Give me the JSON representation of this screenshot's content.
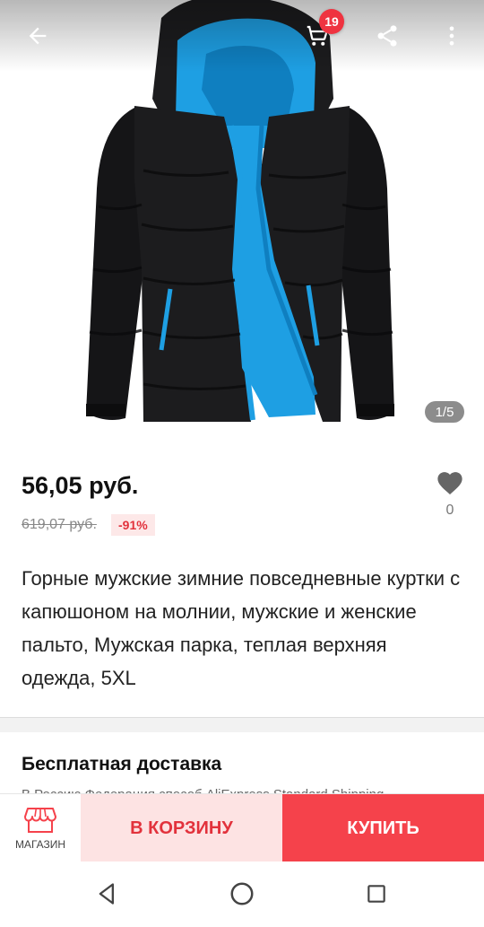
{
  "colors": {
    "accent": "#f5424b",
    "accent_light": "#fde3e3",
    "badge": "#ef3340",
    "jacket_body": "#1c1c1e",
    "jacket_lining": "#1e9fe3"
  },
  "header": {
    "back_icon": "arrow-left-icon",
    "cart_icon": "cart-icon",
    "cart_count": "19",
    "share_icon": "share-icon",
    "more_icon": "more-vertical-icon"
  },
  "gallery": {
    "counter": "1/5"
  },
  "product": {
    "price": "56,05 руб.",
    "old_price": "619,07 руб.",
    "discount": "-91%",
    "wishlist_count": "0",
    "title": "Горные мужские зимние повседневные куртки с капюшоном на молнии, мужские и женские пальто, Мужская парка, теплая верхняя одежда, 5XL"
  },
  "shipping": {
    "title": "Бесплатная доставка",
    "subtitle": "В Россию Федерация способ AliExpress Standard Shipping"
  },
  "actions": {
    "store_label": "МАГАЗИН",
    "add_to_cart": "В КОРЗИНУ",
    "buy": "КУПИТЬ"
  },
  "system_nav": {
    "back_icon": "nav-back-icon",
    "home_icon": "nav-home-icon",
    "recent_icon": "nav-recent-icon"
  }
}
